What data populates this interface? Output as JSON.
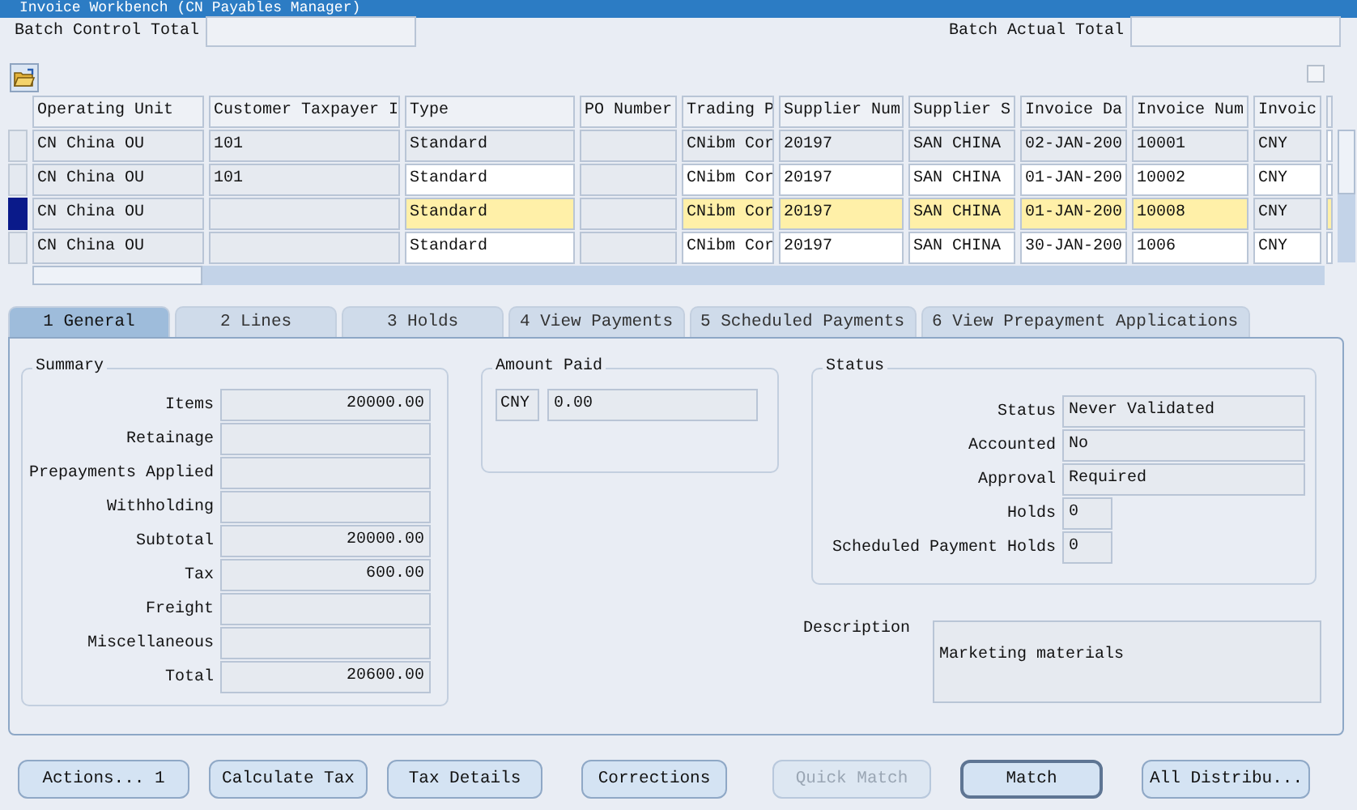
{
  "window": {
    "title": "Invoice Workbench (CN Payables Manager)"
  },
  "batch": {
    "control_label": "Batch Control Total",
    "actual_label": "Batch Actual Total"
  },
  "toolbar": {
    "checkbox_checked": false
  },
  "table": {
    "columns": [
      "Operating Unit",
      "Customer Taxpayer I",
      "Type",
      "PO Number",
      "Trading P",
      "Supplier Num",
      "Supplier S",
      "Invoice Da",
      "Invoice Num",
      "Invoic"
    ],
    "rows": [
      {
        "selected": false,
        "cells": [
          {
            "text": "CN China OU",
            "editable": false
          },
          {
            "text": "101",
            "editable": false
          },
          {
            "text": "Standard",
            "editable": false
          },
          {
            "editable": false
          },
          {
            "text": "CNibm Cor",
            "editable": false
          },
          {
            "text": "20197",
            "editable": false
          },
          {
            "text": "SAN CHINA",
            "editable": false
          },
          {
            "text": "02-JAN-200",
            "editable": false
          },
          {
            "text": "10001",
            "editable": false
          },
          {
            "text": "CNY",
            "editable": false
          }
        ]
      },
      {
        "selected": false,
        "cells": [
          {
            "text": "CN China OU",
            "editable": false
          },
          {
            "text": "101",
            "editable": false
          },
          {
            "text": "Standard",
            "editable": true
          },
          {
            "editable": false
          },
          {
            "text": "CNibm Cor",
            "editable": true
          },
          {
            "text": "20197",
            "editable": true
          },
          {
            "text": "SAN CHINA",
            "editable": true
          },
          {
            "text": "01-JAN-200",
            "editable": true
          },
          {
            "text": "10002",
            "editable": true
          },
          {
            "text": "CNY",
            "editable": true
          }
        ]
      },
      {
        "selected": true,
        "cells": [
          {
            "text": "CN China OU",
            "editable": false
          },
          {
            "editable": false
          },
          {
            "text": "Standard",
            "editable": true
          },
          {
            "editable": false
          },
          {
            "text": "CNibm Cor",
            "editable": true
          },
          {
            "text": "20197",
            "editable": true
          },
          {
            "text": "SAN CHINA",
            "editable": true
          },
          {
            "text": "01-JAN-200",
            "editable": true
          },
          {
            "text": "10008",
            "editable": true
          },
          {
            "text": "CNY",
            "editable": false
          }
        ]
      },
      {
        "selected": false,
        "cells": [
          {
            "text": "CN China OU",
            "editable": false
          },
          {
            "editable": false
          },
          {
            "text": "Standard",
            "editable": true
          },
          {
            "editable": false
          },
          {
            "text": "CNibm Cor",
            "editable": true
          },
          {
            "text": "20197",
            "editable": true
          },
          {
            "text": "SAN CHINA",
            "editable": true
          },
          {
            "text": "30-JAN-200",
            "editable": true
          },
          {
            "text": "1006",
            "editable": true
          },
          {
            "text": "CNY",
            "editable": true
          }
        ]
      }
    ]
  },
  "tabs": [
    {
      "label": "1 General",
      "selected": true
    },
    {
      "label": "2 Lines",
      "selected": false
    },
    {
      "label": "3 Holds",
      "selected": false
    },
    {
      "label": "4 View Payments",
      "selected": false
    },
    {
      "label": "5 Scheduled Payments",
      "selected": false
    },
    {
      "label": "6 View Prepayment Applications",
      "selected": false
    }
  ],
  "summary": {
    "title": "Summary",
    "fields": [
      {
        "label": "Items",
        "value": "20000.00"
      },
      {
        "label": "Retainage"
      },
      {
        "label": "Prepayments Applied"
      },
      {
        "label": "Withholding"
      },
      {
        "label": "Subtotal",
        "value": "20000.00"
      },
      {
        "label": "Tax",
        "value": "600.00"
      },
      {
        "label": "Freight"
      },
      {
        "label": "Miscellaneous"
      },
      {
        "label": "Total",
        "value": "20600.00"
      }
    ]
  },
  "amount_paid": {
    "title": "Amount Paid",
    "currency": "CNY",
    "value": "0.00"
  },
  "status": {
    "title": "Status",
    "fields": [
      {
        "label": "Status",
        "value": "Never Validated",
        "kind": "wide"
      },
      {
        "label": "Accounted",
        "value": "No",
        "kind": "wide"
      },
      {
        "label": "Approval",
        "value": "Required",
        "kind": "wide"
      },
      {
        "label": "Holds",
        "value": "0",
        "kind": "narrow"
      },
      {
        "label": "Scheduled Payment Holds",
        "value": "0",
        "kind": "narrow"
      }
    ]
  },
  "description": {
    "label": "Description",
    "value": "Marketing materials"
  },
  "buttons": [
    {
      "label": "Actions... 1",
      "disabled": false,
      "default": false
    },
    {
      "label": "Calculate Tax",
      "disabled": false,
      "default": false
    },
    {
      "label": "Tax Details",
      "disabled": false,
      "default": false
    },
    {
      "label": "Corrections",
      "disabled": false,
      "default": false
    },
    {
      "label": "Quick Match",
      "disabled": true,
      "default": false
    },
    {
      "label": "Match",
      "disabled": false,
      "default": true
    },
    {
      "label": "All Distribu...",
      "disabled": false,
      "default": false
    }
  ]
}
